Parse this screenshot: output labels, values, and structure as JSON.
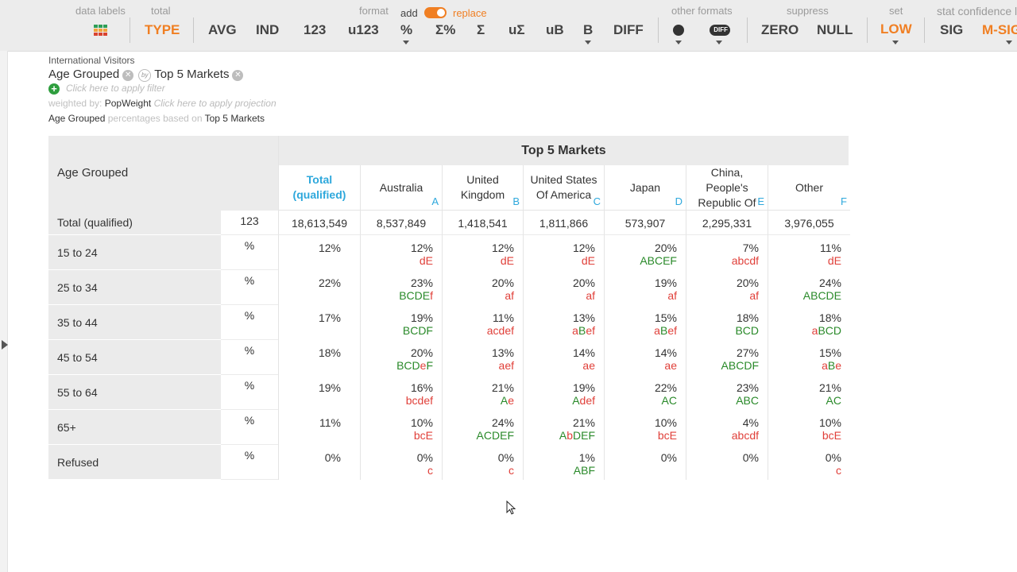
{
  "toolbar": {
    "labels": {
      "data_labels": "data labels",
      "total": "total",
      "format": "format",
      "add": "add",
      "replace": "replace",
      "other_formats": "other formats",
      "suppress": "suppress",
      "set": "set",
      "stat_confidence": "stat confidence le"
    },
    "buttons": {
      "type": "TYPE",
      "avg": "AVG",
      "ind": "IND",
      "n123": "123",
      "u123": "u123",
      "pct": "%",
      "sum_pct": "Σ%",
      "sum": "Σ",
      "u_sum": "uΣ",
      "ub": "uB",
      "b": "B",
      "diff": "DIFF",
      "diff_icon": "DIFF",
      "zero": "ZERO",
      "null": "NULL",
      "low": "LOW",
      "sig": "SIG",
      "msig": "M-SIG"
    },
    "toggle_on": true,
    "accent_color": "#f07f23"
  },
  "header": {
    "dataset": "International Visitors",
    "row_var": "Age Grouped",
    "by": "by",
    "col_var": "Top 5 Markets",
    "filter_hint": "Click here to apply filter",
    "weighted_by_label": "weighted by:",
    "weight": "PopWeight",
    "projection_hint": "Click here to apply projection",
    "pct_row_var": "Age Grouped",
    "pct_text": "percentages based on",
    "pct_col_var": "Top 5 Markets"
  },
  "table": {
    "banner": "Top 5 Markets",
    "row_header": "Age Grouped",
    "total_col": "Total (qualified)",
    "columns": [
      {
        "name": "Australia",
        "letter": "A"
      },
      {
        "name": "United Kingdom",
        "letter": "B"
      },
      {
        "name": "United States Of America",
        "letter": "C"
      },
      {
        "name": "Japan",
        "letter": "D"
      },
      {
        "name": "China, People's Republic Of",
        "letter": "E"
      },
      {
        "name": "Other",
        "letter": "F"
      }
    ],
    "total_row": {
      "label": "Total (qualified)",
      "stat": "123",
      "values": [
        "18,613,549",
        "8,537,849",
        "1,418,541",
        "1,811,866",
        "573,907",
        "2,295,331",
        "3,976,055"
      ]
    },
    "rows": [
      {
        "label": "15 to 24",
        "stat": "%",
        "total": "12%",
        "cells": [
          {
            "v": "12%",
            "sig": [
              [
                "d",
                "r"
              ],
              [
                "E",
                "r"
              ]
            ]
          },
          {
            "v": "12%",
            "sig": [
              [
                "d",
                "r"
              ],
              [
                "E",
                "r"
              ]
            ]
          },
          {
            "v": "12%",
            "sig": [
              [
                "d",
                "r"
              ],
              [
                "E",
                "r"
              ]
            ]
          },
          {
            "v": "20%",
            "sig": [
              [
                "ABCEF",
                "g"
              ]
            ]
          },
          {
            "v": "7%",
            "sig": [
              [
                "abcdf",
                "r"
              ]
            ]
          },
          {
            "v": "11%",
            "sig": [
              [
                "d",
                "r"
              ],
              [
                "E",
                "r"
              ]
            ]
          }
        ]
      },
      {
        "label": "25 to 34",
        "stat": "%",
        "total": "22%",
        "cells": [
          {
            "v": "23%",
            "sig": [
              [
                "BCDE",
                "g"
              ],
              [
                "f",
                "r"
              ]
            ]
          },
          {
            "v": "20%",
            "sig": [
              [
                "af",
                "r"
              ]
            ]
          },
          {
            "v": "20%",
            "sig": [
              [
                "af",
                "r"
              ]
            ]
          },
          {
            "v": "19%",
            "sig": [
              [
                "af",
                "r"
              ]
            ]
          },
          {
            "v": "20%",
            "sig": [
              [
                "af",
                "r"
              ]
            ]
          },
          {
            "v": "24%",
            "sig": [
              [
                "ABCDE",
                "g"
              ]
            ]
          }
        ]
      },
      {
        "label": "35 to 44",
        "stat": "%",
        "total": "17%",
        "cells": [
          {
            "v": "19%",
            "sig": [
              [
                "BCDF",
                "g"
              ]
            ]
          },
          {
            "v": "11%",
            "sig": [
              [
                "acdef",
                "r"
              ]
            ]
          },
          {
            "v": "13%",
            "sig": [
              [
                "a",
                "r"
              ],
              [
                "B",
                "g"
              ],
              [
                "ef",
                "r"
              ]
            ]
          },
          {
            "v": "15%",
            "sig": [
              [
                "a",
                "r"
              ],
              [
                "B",
                "g"
              ],
              [
                "ef",
                "r"
              ]
            ]
          },
          {
            "v": "18%",
            "sig": [
              [
                "BCD",
                "g"
              ]
            ]
          },
          {
            "v": "18%",
            "sig": [
              [
                "a",
                "r"
              ],
              [
                "BCD",
                "g"
              ]
            ]
          }
        ]
      },
      {
        "label": "45 to 54",
        "stat": "%",
        "total": "18%",
        "cells": [
          {
            "v": "20%",
            "sig": [
              [
                "BCD",
                "g"
              ],
              [
                "e",
                "r"
              ],
              [
                "F",
                "g"
              ]
            ]
          },
          {
            "v": "13%",
            "sig": [
              [
                "aef",
                "r"
              ]
            ]
          },
          {
            "v": "14%",
            "sig": [
              [
                "ae",
                "r"
              ]
            ]
          },
          {
            "v": "14%",
            "sig": [
              [
                "ae",
                "r"
              ]
            ]
          },
          {
            "v": "27%",
            "sig": [
              [
                "ABCDF",
                "g"
              ]
            ]
          },
          {
            "v": "15%",
            "sig": [
              [
                "a",
                "r"
              ],
              [
                "B",
                "g"
              ],
              [
                "e",
                "r"
              ]
            ]
          }
        ]
      },
      {
        "label": "55 to 64",
        "stat": "%",
        "total": "19%",
        "cells": [
          {
            "v": "16%",
            "sig": [
              [
                "bcdef",
                "r"
              ]
            ]
          },
          {
            "v": "21%",
            "sig": [
              [
                "A",
                "g"
              ],
              [
                "e",
                "r"
              ]
            ]
          },
          {
            "v": "19%",
            "sig": [
              [
                "A",
                "g"
              ],
              [
                "def",
                "r"
              ]
            ]
          },
          {
            "v": "22%",
            "sig": [
              [
                "AC",
                "g"
              ]
            ]
          },
          {
            "v": "23%",
            "sig": [
              [
                "ABC",
                "g"
              ]
            ]
          },
          {
            "v": "21%",
            "sig": [
              [
                "AC",
                "g"
              ]
            ]
          }
        ]
      },
      {
        "label": "65+",
        "stat": "%",
        "total": "11%",
        "cells": [
          {
            "v": "10%",
            "sig": [
              [
                "bc",
                "r"
              ],
              [
                "E",
                "r"
              ]
            ]
          },
          {
            "v": "24%",
            "sig": [
              [
                "ACDEF",
                "g"
              ]
            ]
          },
          {
            "v": "21%",
            "sig": [
              [
                "A",
                "g"
              ],
              [
                "b",
                "r"
              ],
              [
                "DEF",
                "g"
              ]
            ]
          },
          {
            "v": "10%",
            "sig": [
              [
                "bc",
                "r"
              ],
              [
                "E",
                "r"
              ]
            ]
          },
          {
            "v": "4%",
            "sig": [
              [
                "abcdf",
                "r"
              ]
            ]
          },
          {
            "v": "10%",
            "sig": [
              [
                "bc",
                "r"
              ],
              [
                "E",
                "r"
              ]
            ]
          }
        ]
      },
      {
        "label": "Refused",
        "stat": "%",
        "total": "0%",
        "cells": [
          {
            "v": "0%",
            "sig": [
              [
                "c",
                "r"
              ]
            ]
          },
          {
            "v": "0%",
            "sig": [
              [
                "c",
                "r"
              ]
            ]
          },
          {
            "v": "1%",
            "sig": [
              [
                "ABF",
                "g"
              ]
            ]
          },
          {
            "v": "0%",
            "sig": []
          },
          {
            "v": "0%",
            "sig": []
          },
          {
            "v": "0%",
            "sig": [
              [
                "c",
                "r"
              ]
            ]
          }
        ]
      }
    ]
  }
}
